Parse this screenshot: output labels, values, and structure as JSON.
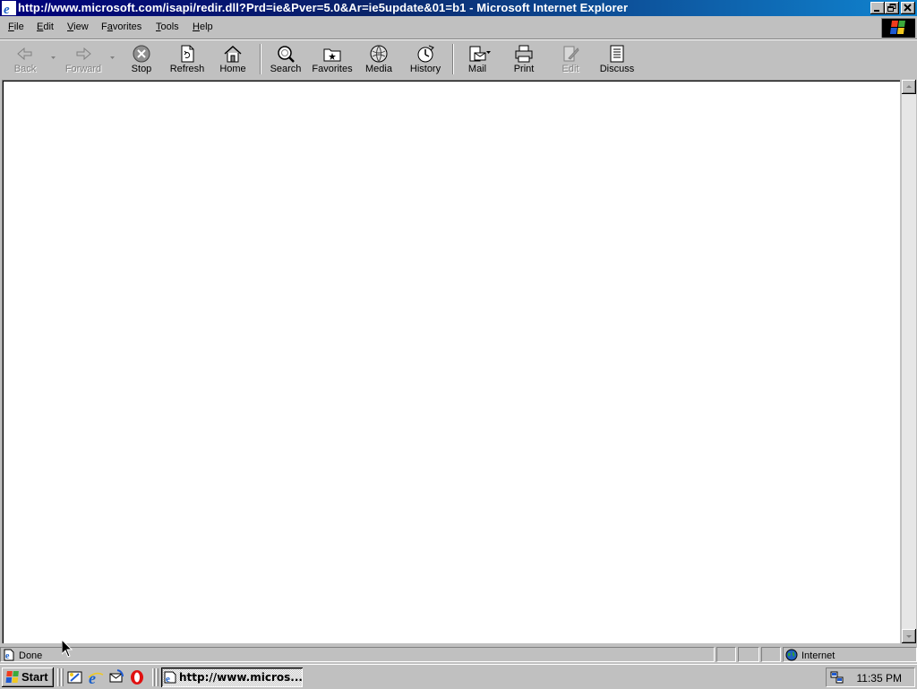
{
  "window": {
    "title": "http://www.microsoft.com/isapi/redir.dll?Prd=ie&Pver=5.0&Ar=ie5update&01=b1 - Microsoft Internet Explorer"
  },
  "menu": {
    "items": [
      {
        "label": "File",
        "accel": "F"
      },
      {
        "label": "Edit",
        "accel": "E"
      },
      {
        "label": "View",
        "accel": "V"
      },
      {
        "label": "Favorites",
        "accel": "a"
      },
      {
        "label": "Tools",
        "accel": "T"
      },
      {
        "label": "Help",
        "accel": "H"
      }
    ]
  },
  "toolbar": {
    "back": "Back",
    "forward": "Forward",
    "stop": "Stop",
    "refresh": "Refresh",
    "home": "Home",
    "search": "Search",
    "favorites": "Favorites",
    "media": "Media",
    "history": "History",
    "mail": "Mail",
    "print": "Print",
    "edit": "Edit",
    "discuss": "Discuss"
  },
  "status": {
    "text": "Done",
    "zone": "Internet"
  },
  "taskbar": {
    "start": "Start",
    "task_label": "http://www.micros...",
    "clock": "11:35 PM"
  },
  "icons": {
    "titlebar": "ie-icon",
    "minimize": "minimize-icon",
    "restore": "restore-icon",
    "close": "close-icon",
    "windows_logo": "windows-logo-icon"
  },
  "colors": {
    "titlebar_start": "#00007b",
    "titlebar_end": "#1084d0",
    "chrome": "#c0c0c0",
    "page_bg": "#ffffff"
  }
}
